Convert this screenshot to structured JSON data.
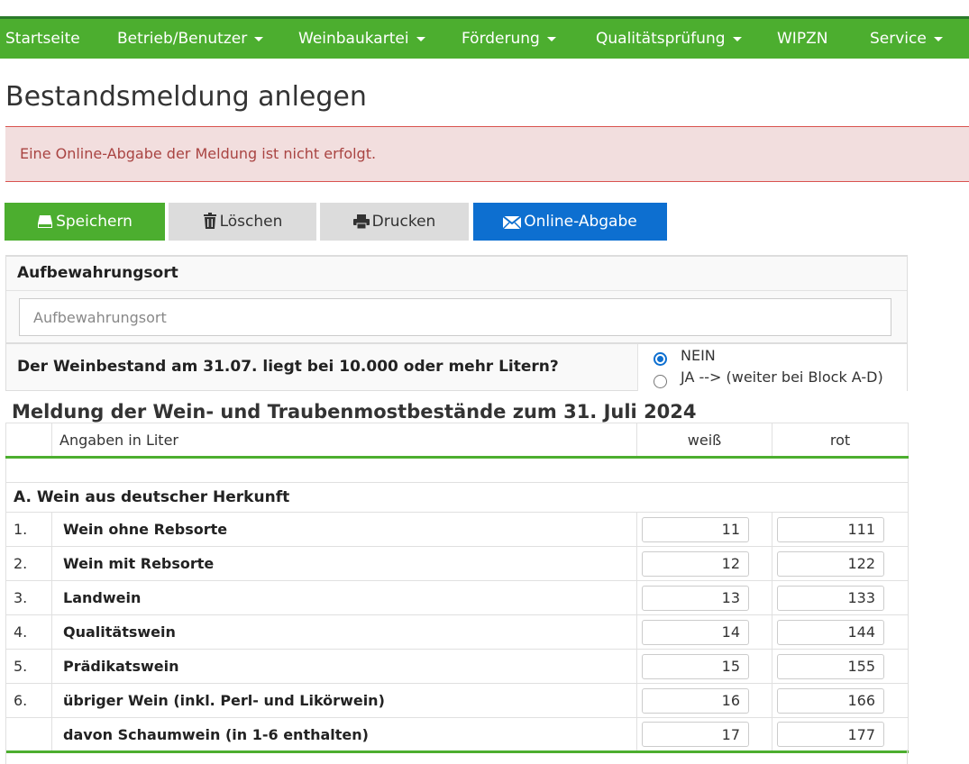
{
  "nav": {
    "items": [
      {
        "label": "Startseite",
        "dropdown": false
      },
      {
        "label": "Betrieb/Benutzer",
        "dropdown": true
      },
      {
        "label": "Weinbaukartei",
        "dropdown": true
      },
      {
        "label": "Förderung",
        "dropdown": true
      },
      {
        "label": "Qualitätsprüfung",
        "dropdown": true
      },
      {
        "label": "WIPZN",
        "dropdown": false
      },
      {
        "label": "Service",
        "dropdown": true
      }
    ]
  },
  "page": {
    "title": "Bestandsmeldung anlegen",
    "alert": "Eine Online-Abgabe der Meldung ist nicht erfolgt."
  },
  "toolbar": {
    "save": "Speichern",
    "delete": "Löschen",
    "print": "Drucken",
    "submit": "Online-Abgabe"
  },
  "storage": {
    "label": "Aufbewahrungsort",
    "placeholder": "Aufbewahrungsort",
    "value": ""
  },
  "question": {
    "text": "Der Weinbestand am 31.07. liegt bei 10.000 oder mehr Litern?",
    "options": [
      "NEIN",
      "JA --> (weiter bei Block A-D)"
    ],
    "selected": "NEIN"
  },
  "report": {
    "title": "Meldung der Wein- und Traubenmostbestände zum 31. Juli 2024",
    "header": {
      "label": "Angaben in Liter",
      "col_white": "weiß",
      "col_red": "rot"
    },
    "block_a": {
      "title": "A. Wein aus deutscher Herkunft",
      "rows": [
        {
          "num": "1.",
          "label": "Wein ohne Rebsorte",
          "white": "11",
          "red": "111"
        },
        {
          "num": "2.",
          "label": "Wein mit Rebsorte",
          "white": "12",
          "red": "122"
        },
        {
          "num": "3.",
          "label": "Landwein",
          "white": "13",
          "red": "133"
        },
        {
          "num": "4.",
          "label": "Qualitätswein",
          "white": "14",
          "red": "144"
        },
        {
          "num": "5.",
          "label": "Prädikatswein",
          "white": "15",
          "red": "155"
        },
        {
          "num": "6.",
          "label": "übriger Wein (inkl. Perl- und Likörwein)",
          "white": "16",
          "red": "166"
        },
        {
          "num": "",
          "label": "davon Schaumwein (in 1-6 enthalten)",
          "white": "17",
          "red": "177"
        }
      ]
    }
  },
  "colors": {
    "nav_green": "#4cae2f",
    "submit_blue": "#0d6fd0",
    "alert_bg": "#f2dede",
    "alert_text": "#a94442"
  }
}
